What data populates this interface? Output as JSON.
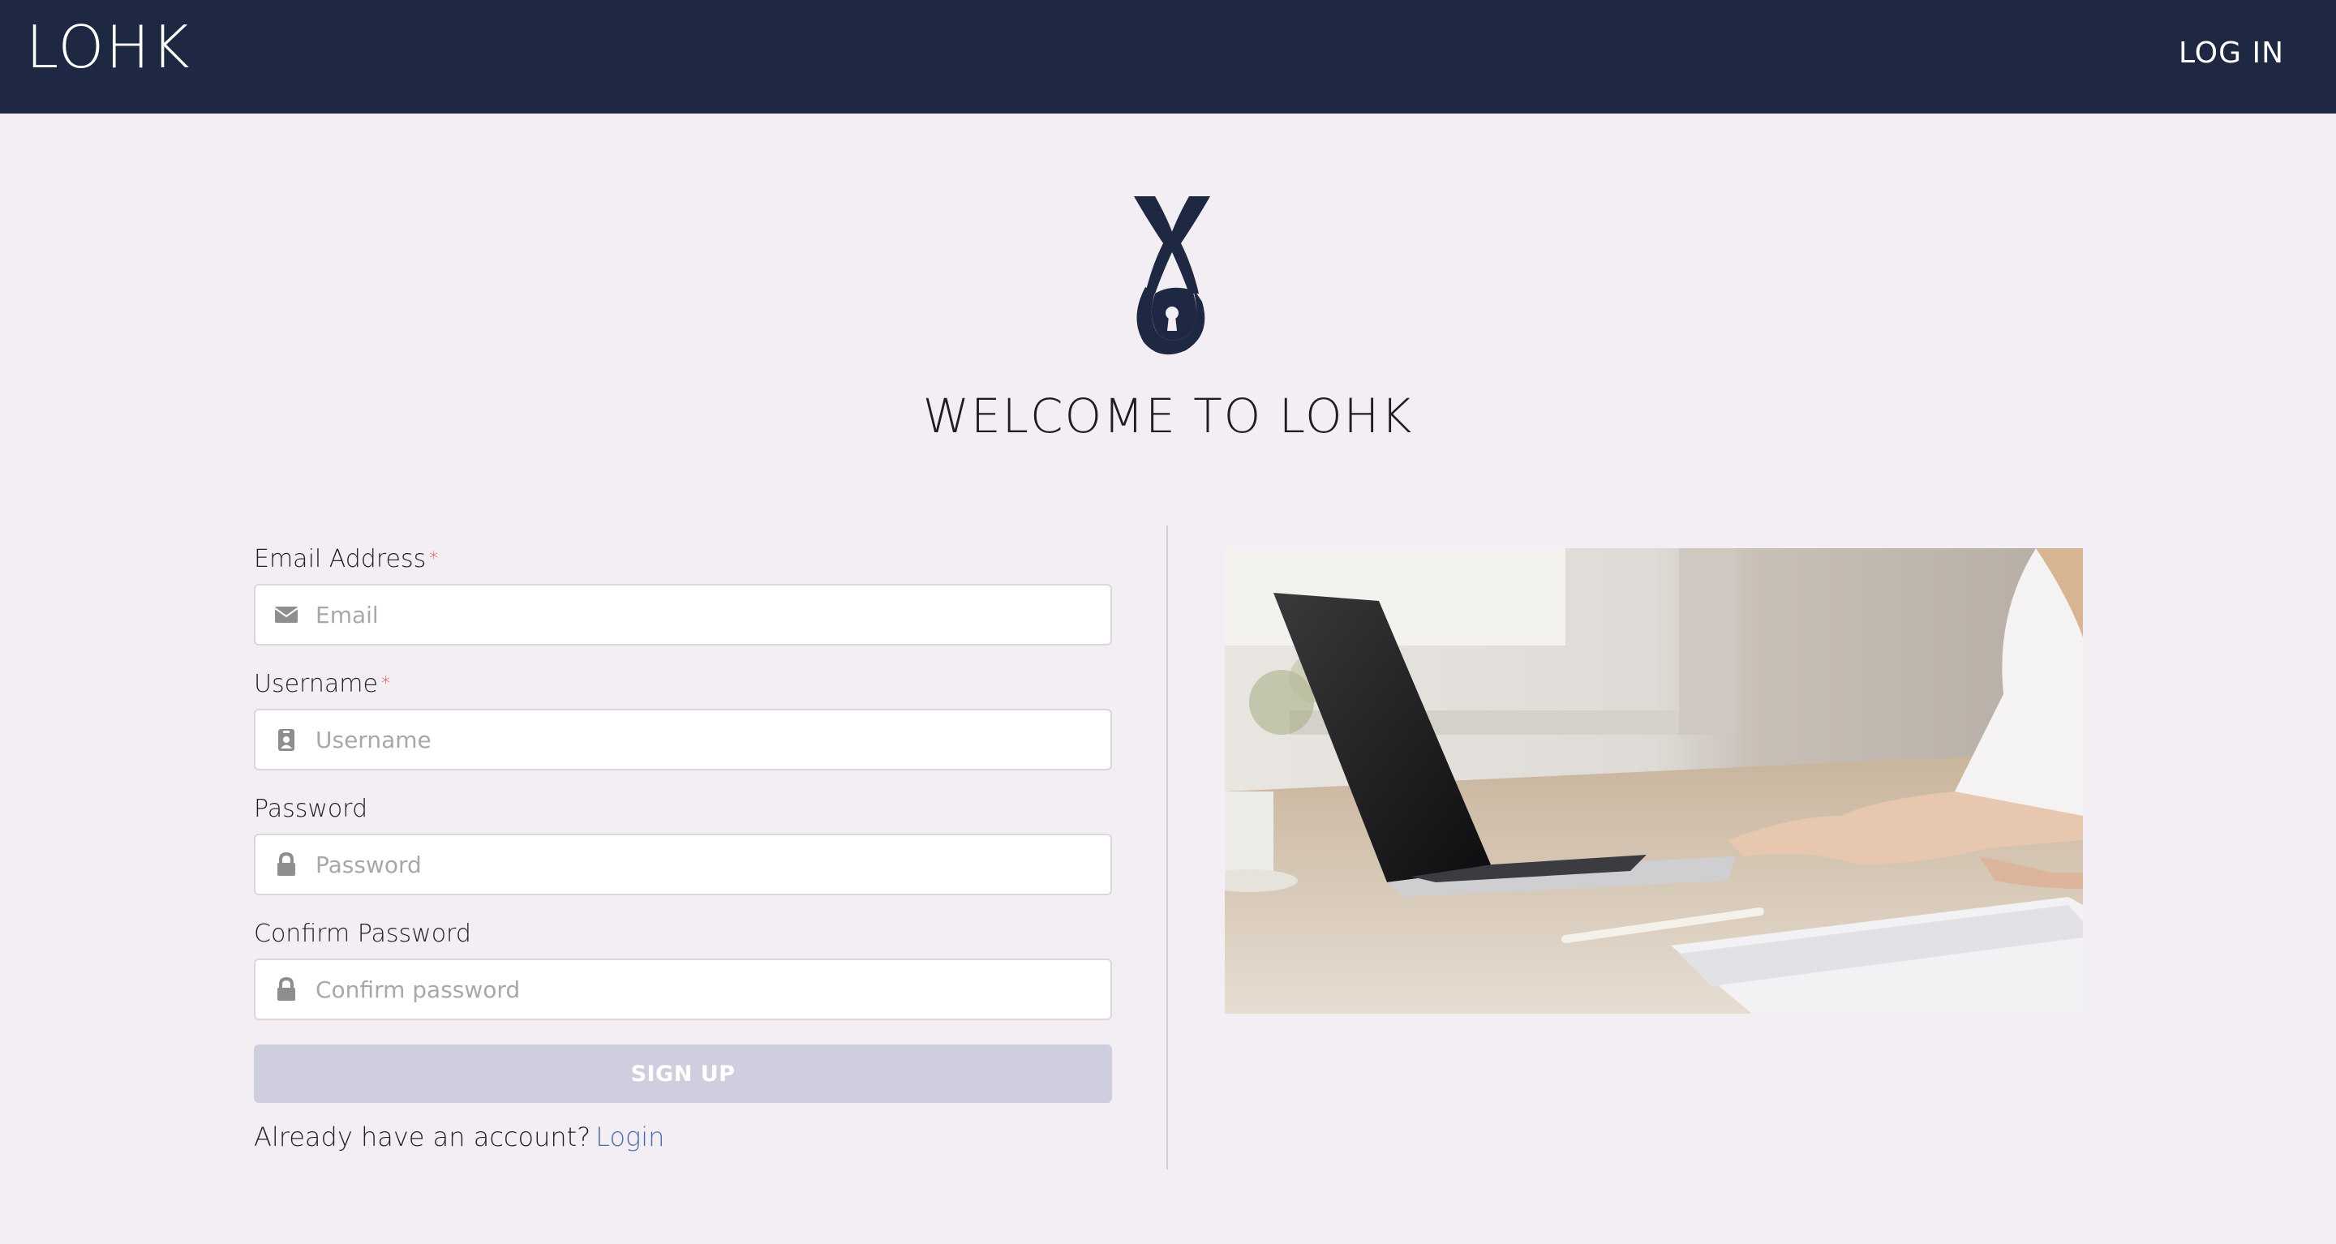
{
  "header": {
    "brand": "LOHK",
    "login_label": "LOG IN"
  },
  "main": {
    "title": "WELCOME TO LOHK"
  },
  "form": {
    "email": {
      "label": "Email Address",
      "required_mark": "*",
      "placeholder": "Email",
      "icon": "envelope-icon"
    },
    "username": {
      "label": "Username",
      "required_mark": "*",
      "placeholder": "Username",
      "icon": "id-badge-icon"
    },
    "password": {
      "label": "Password",
      "placeholder": "Password",
      "icon": "lock-icon"
    },
    "confirm_password": {
      "label": "Confirm Password",
      "placeholder": "Confirm password",
      "icon": "lock-icon"
    },
    "submit_label": "SIGN UP",
    "footer_text": "Already have an account?",
    "footer_link": "Login"
  },
  "colors": {
    "header_bg": "#1e2843",
    "page_bg": "#f3eef4",
    "button_disabled": "#cfcedf",
    "link": "#4a6ea9",
    "required": "#d23a3a"
  }
}
